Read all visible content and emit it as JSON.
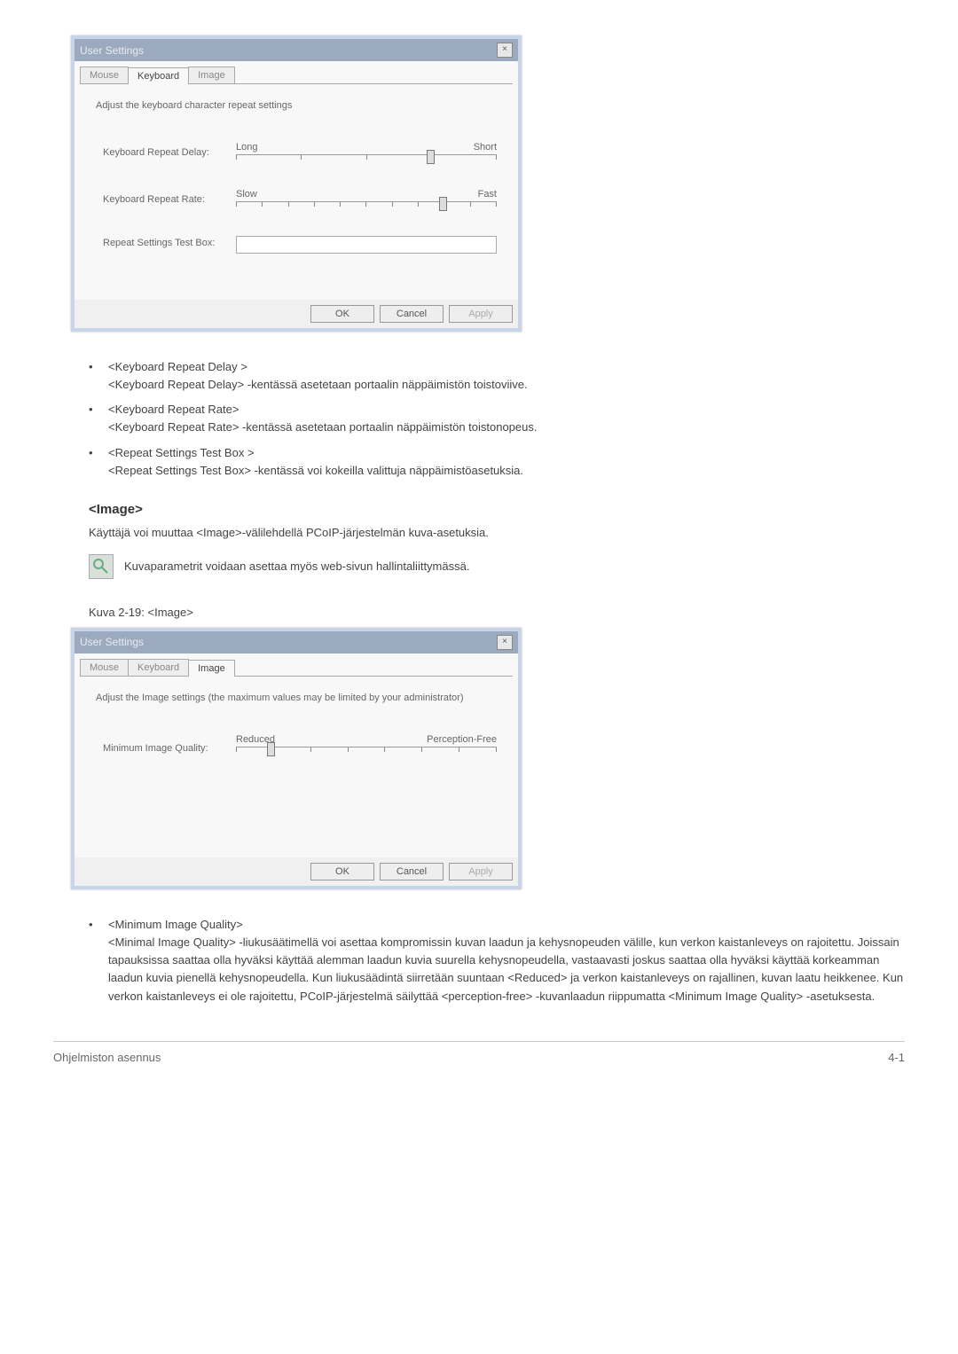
{
  "dialog1": {
    "title": "User Settings",
    "tabs": [
      "Mouse",
      "Keyboard",
      "Image"
    ],
    "active_tab": 1,
    "desc": "Adjust the keyboard character repeat settings",
    "rows": {
      "delay": {
        "label": "Keyboard Repeat Delay:",
        "left": "Long",
        "right": "Short",
        "ticks": 5,
        "pos": 73
      },
      "rate": {
        "label": "Keyboard Repeat Rate:",
        "left": "Slow",
        "right": "Fast",
        "ticks": 11,
        "pos": 78
      },
      "test": {
        "label": "Repeat Settings Test Box:"
      }
    },
    "buttons": {
      "ok": "OK",
      "cancel": "Cancel",
      "apply": "Apply"
    }
  },
  "bullets1": [
    {
      "title": "<Keyboard Repeat Delay >",
      "body": "<Keyboard Repeat Delay> -kentässä asetetaan portaalin näppäimistön toistoviive."
    },
    {
      "title": "<Keyboard Repeat Rate>",
      "body": "<Keyboard Repeat Rate> -kentässä asetetaan portaalin näppäimistön toistonopeus."
    },
    {
      "title": "<Repeat Settings Test Box >",
      "body": "<Repeat Settings Test Box> -kentässä voi kokeilla valittuja näppäimistöasetuksia."
    }
  ],
  "section": {
    "heading": "<Image>",
    "intro": "Käyttäjä voi muuttaa <Image>-välilehdellä PCoIP-järjestelmän kuva-asetuksia.",
    "note": "Kuvaparametrit voidaan asettaa myös web-sivun hallintaliittymässä.",
    "caption": "Kuva 2-19: <Image>"
  },
  "dialog2": {
    "title": "User Settings",
    "tabs": [
      "Mouse",
      "Keyboard",
      "Image"
    ],
    "active_tab": 2,
    "desc": "Adjust the Image settings (the maximum values may be limited by your administrator)",
    "row": {
      "label": "Minimum Image Quality:",
      "left": "Reduced",
      "right": "Perception-Free",
      "ticks": 8,
      "pos": 12
    },
    "buttons": {
      "ok": "OK",
      "cancel": "Cancel",
      "apply": "Apply"
    }
  },
  "bullets2": [
    {
      "title": "<Minimum Image Quality>",
      "body": "<Minimal Image Quality> -liukusäätimellä voi asettaa kompromissin kuvan laadun ja kehysnopeuden välille, kun verkon kaistanleveys on rajoitettu. Joissain tapauksissa saattaa olla hyväksi käyttää alemman laadun kuvia suurella kehysnopeudella, vastaavasti joskus saattaa olla hyväksi käyttää korkeamman laadun kuvia pienellä kehysnopeudella. Kun liukusäädintä siirretään suuntaan <Reduced> ja verkon kaistanleveys on rajallinen, kuvan laatu heikkenee. Kun verkon kaistanleveys ei ole rajoitettu, PCoIP-järjestelmä säilyttää <perception-free> -kuvanlaadun riippumatta <Minimum Image Quality> -asetuksesta."
    }
  ],
  "footer": {
    "left": "Ohjelmiston asennus",
    "right": "4-1"
  }
}
